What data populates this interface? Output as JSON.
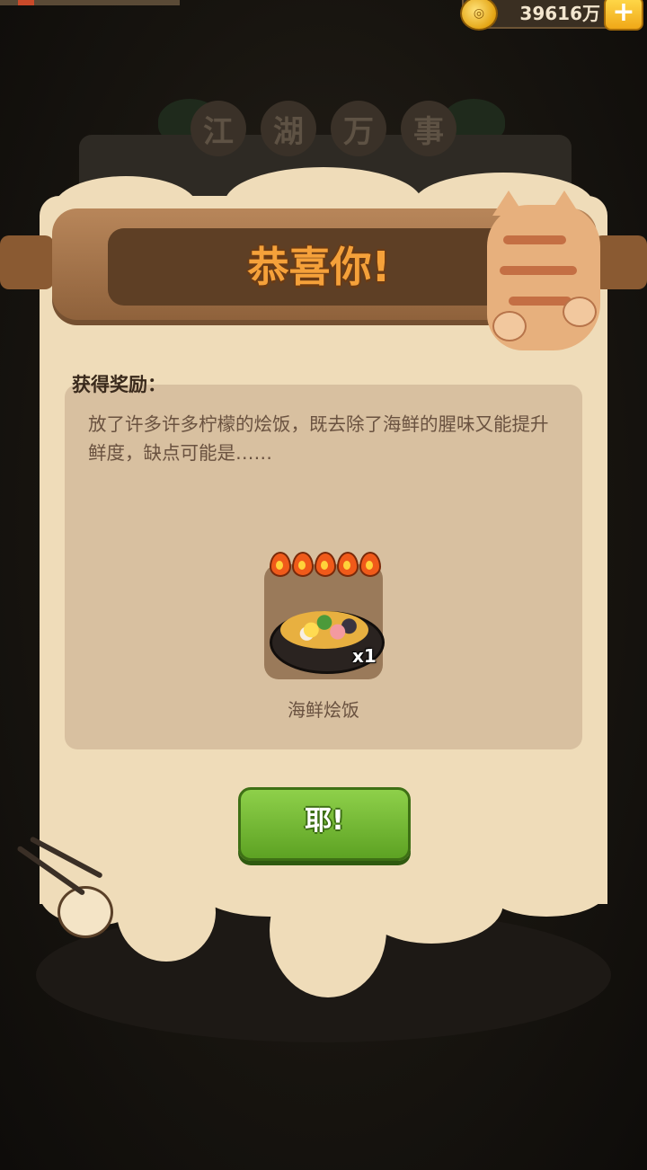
{
  "status": {
    "coins": "39616万",
    "add_icon": "plus-icon",
    "coin_icon": "coin-icon"
  },
  "background": {
    "title_chars": [
      "江",
      "湖",
      "万",
      "事"
    ]
  },
  "dialog": {
    "title": "恭喜你!",
    "reward_label": "获得奖励：",
    "description": "放了许多许多柠檬的烩饭，既去除了海鲜的腥味又能提升鲜度，缺点可能是……",
    "item": {
      "name": "海鲜烩饭",
      "quantity": "x1",
      "flame_count": 5,
      "icon": "seafood-paella-icon"
    },
    "confirm_label": "耶!"
  },
  "colors": {
    "title": "#f5a13a",
    "button": "#6db52e",
    "sheet": "#efdcb9",
    "panel": "#d8c0a0"
  }
}
